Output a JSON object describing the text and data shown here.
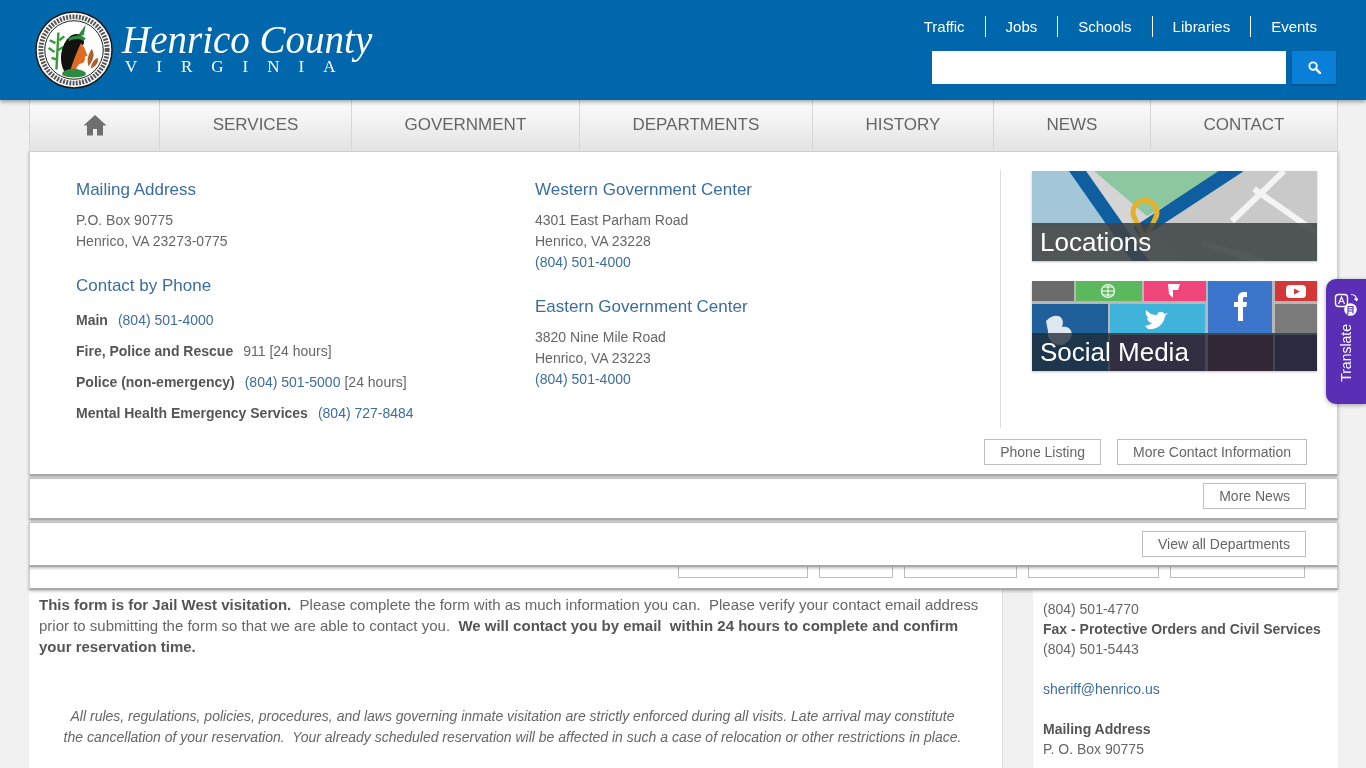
{
  "header": {
    "logo": {
      "title": "Henrico County",
      "subtitle": "VIRGINIA"
    },
    "top_links": [
      "Traffic",
      "Jobs",
      "Schools",
      "Libraries",
      "Events"
    ]
  },
  "nav": {
    "items": [
      {
        "kind": "home"
      },
      {
        "kind": "text",
        "label": "SERVICES"
      },
      {
        "kind": "text",
        "label": "GOVERNMENT"
      },
      {
        "kind": "text",
        "label": "DEPARTMENTS"
      },
      {
        "kind": "text",
        "label": "HISTORY"
      },
      {
        "kind": "text",
        "label": "NEWS"
      },
      {
        "kind": "text",
        "label": "CONTACT"
      }
    ]
  },
  "contact_menu": {
    "mailing": {
      "heading": "Mailing Address",
      "lines": [
        "P.O. Box 90775",
        "Henrico, VA 23273-0775"
      ]
    },
    "phone": {
      "heading": "Contact by Phone",
      "rows": [
        {
          "label": "Main",
          "parts": [
            {
              "kind": "link",
              "text": "(804) 501-4000"
            }
          ]
        },
        {
          "label": "Fire, Police and Rescue",
          "parts": [
            {
              "kind": "plain",
              "text": "911 [24 hours]"
            }
          ]
        },
        {
          "label": "Police (non-emergency)",
          "parts": [
            {
              "kind": "link",
              "text": "(804) 501-5000"
            },
            {
              "kind": "plain",
              "text": "[24 hours]"
            }
          ]
        },
        {
          "label": "Mental Health Emergency Services",
          "parts": [
            {
              "kind": "link",
              "text": "(804) 727-8484"
            }
          ]
        }
      ]
    },
    "centers": [
      {
        "heading": "Western Government Center",
        "lines": [
          "4301 East Parham Road",
          "Henrico, VA 23228"
        ],
        "phone": "(804) 501-4000"
      },
      {
        "heading": "Eastern Government Center",
        "lines": [
          "3820 Nine Mile Road",
          "Henrico, VA 23223"
        ],
        "phone": "(804) 501-4000"
      }
    ],
    "tiles": [
      {
        "kind": "map",
        "label": "Locations"
      },
      {
        "kind": "social",
        "label": "Social Media"
      }
    ],
    "buttons": [
      "Phone Listing",
      "More Contact Information"
    ]
  },
  "news_menu": {
    "buttons": [
      "More News"
    ]
  },
  "departments_menu": {
    "buttons": [
      "View all Departments"
    ]
  },
  "form_intro": "**This form is for Jail West visitation.**  Please complete the form with as much information you can.  Please verify your contact email address prior to submitting the form so that we are able to contact you.  **We will contact you by email  within 24 hours to complete and confirm your reservation time.**",
  "rules_notice": "All rules, regulations, policies, procedures, and laws governing inmate visitation are strictly enforced during all visits. Late arrival may constitute the cancellation of your reservation.  Your already scheduled reservation will be affected in such a case of relocation or other restrictions in place.",
  "sidebar": {
    "groups": [
      {
        "items": [
          {
            "kind": "text",
            "text": "(804) 501-4770"
          },
          {
            "kind": "heading",
            "text": "Fax - Protective Orders and Civil Services"
          },
          {
            "kind": "text",
            "text": "(804) 501-5443"
          }
        ]
      },
      {
        "items": [
          {
            "kind": "link",
            "text": "sheriff@henrico.us"
          }
        ]
      },
      {
        "items": [
          {
            "kind": "heading",
            "text": "Mailing Address"
          },
          {
            "kind": "text",
            "text": "P. O. Box 90775"
          }
        ]
      }
    ]
  },
  "translate_tab": {
    "label": "Translate"
  }
}
